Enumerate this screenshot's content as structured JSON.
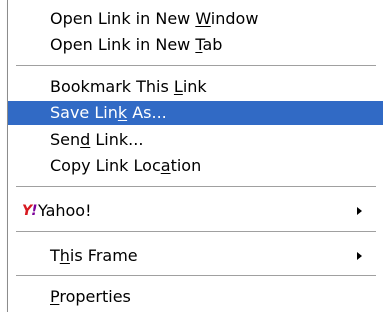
{
  "menu": {
    "open_window": {
      "pre": "Open Link in New ",
      "key": "W",
      "post": "indow"
    },
    "open_tab": {
      "pre": "Open Link in New ",
      "key": "T",
      "post": "ab"
    },
    "bookmark": {
      "pre": "Bookmark This ",
      "key": "L",
      "post": "ink"
    },
    "save_as": {
      "pre": "Save Lin",
      "key": "k",
      "post": " As..."
    },
    "send_link": {
      "pre": "Sen",
      "key": "d",
      "post": " Link..."
    },
    "copy_location": {
      "pre": "Copy Link Loc",
      "key": "a",
      "post": "tion"
    },
    "yahoo": {
      "label": "Yahoo!",
      "icon": "yahoo-icon",
      "icon_text": "Y",
      "icon_mark": "!"
    },
    "this_frame": {
      "pre": "T",
      "key": "h",
      "post": "is Frame"
    },
    "properties": {
      "pre": "",
      "key": "P",
      "post": "roperties"
    }
  },
  "colors": {
    "highlight": "#316ac5",
    "highlight_text": "#ffffff",
    "yahoo_red": "#d71920"
  },
  "selected_item": "Save Link As..."
}
